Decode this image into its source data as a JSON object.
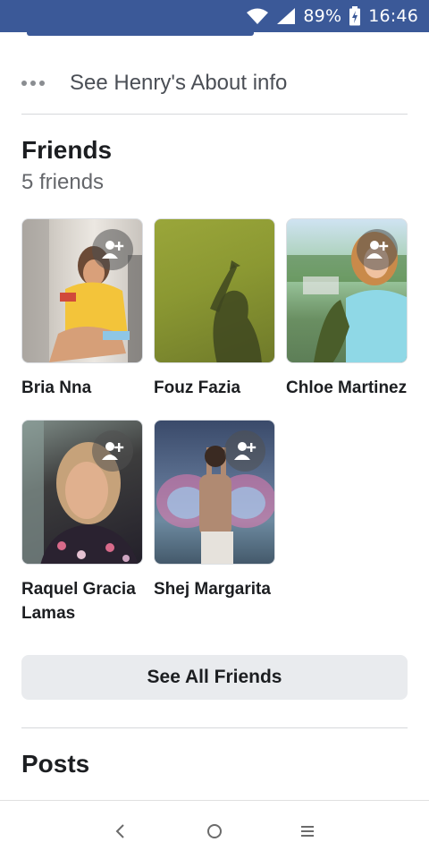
{
  "status_bar": {
    "battery": "89%",
    "time": "16:46",
    "icons": [
      "wifi-icon",
      "signal-icon",
      "battery-icon"
    ]
  },
  "about": {
    "label": "See Henry's About info",
    "icon": "more-dots-icon"
  },
  "friends": {
    "title": "Friends",
    "count": "5 friends",
    "items": [
      {
        "name": "Bria Nna",
        "has_add_button": true
      },
      {
        "name": "Fouz Fazia",
        "has_add_button": false
      },
      {
        "name": "Chloe Martinez",
        "has_add_button": true
      },
      {
        "name": "Raquel Gracia Lamas",
        "has_add_button": true
      },
      {
        "name": "Shej Margarita",
        "has_add_button": true
      }
    ],
    "see_all_label": "See All Friends"
  },
  "posts": {
    "title": "Posts"
  },
  "nav": {
    "buttons": [
      "back-icon",
      "home-icon",
      "recents-icon"
    ]
  },
  "colors": {
    "status_bar": "#3b5998",
    "button_bg": "#e9ebee",
    "text_primary": "#1c1e21",
    "text_secondary": "#65676b"
  }
}
